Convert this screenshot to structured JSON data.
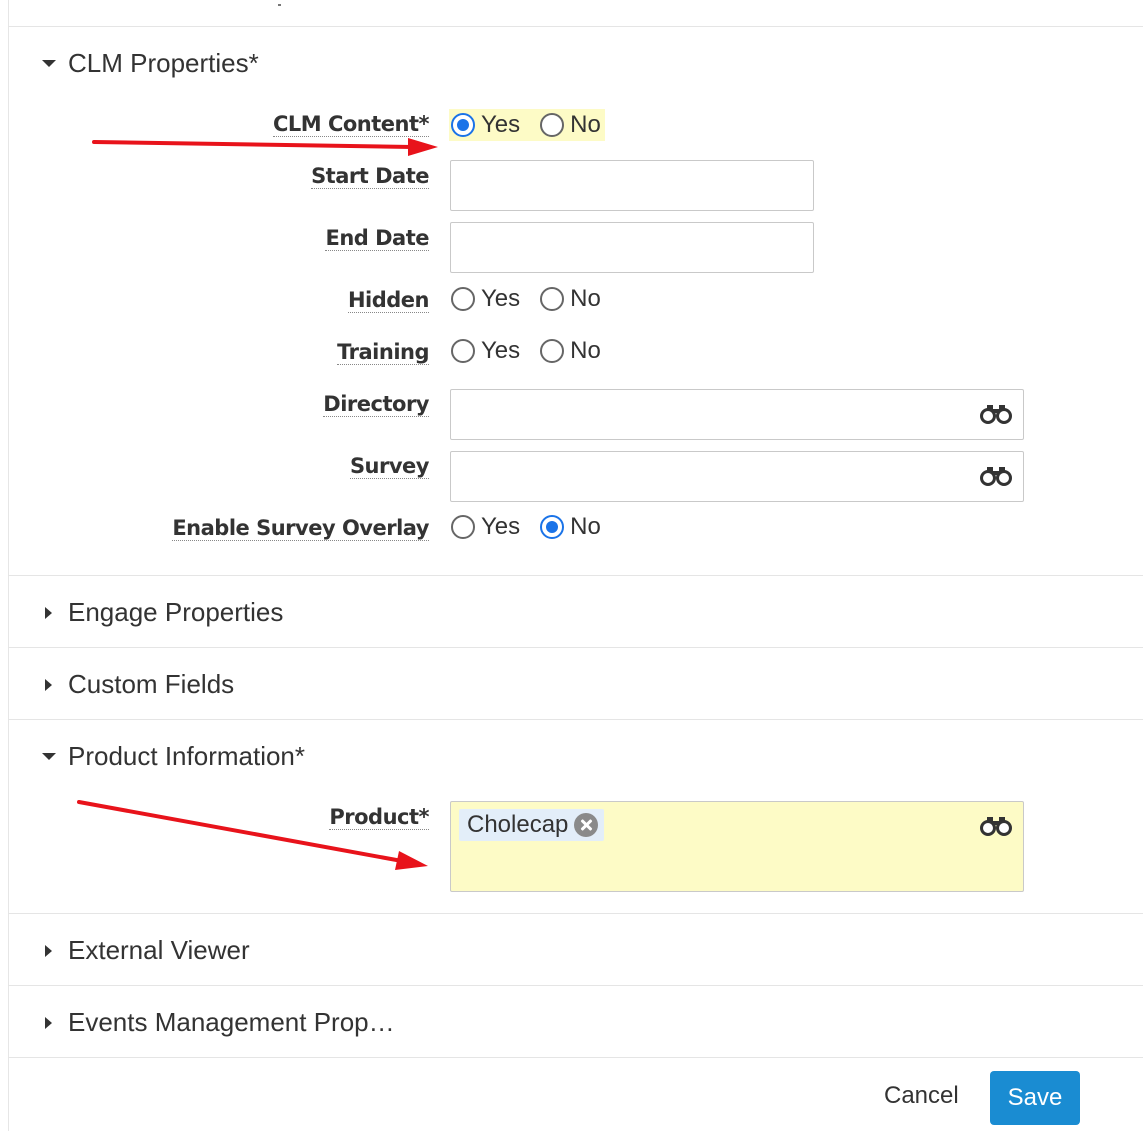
{
  "sections": {
    "clm": {
      "title": "CLM Properties*"
    },
    "engage": {
      "title": "Engage Properties"
    },
    "custom": {
      "title": "Custom Fields"
    },
    "product": {
      "title": "Product Information*"
    },
    "external": {
      "title": "External Viewer"
    },
    "events": {
      "title": "Events Management Prop…"
    }
  },
  "fields": {
    "clm_content": {
      "label": "CLM Content*",
      "yes": "Yes",
      "no": "No",
      "selected": "Yes"
    },
    "start_date": {
      "label": "Start Date",
      "value": ""
    },
    "end_date": {
      "label": "End Date",
      "value": ""
    },
    "hidden": {
      "label": "Hidden",
      "yes": "Yes",
      "no": "No",
      "selected": ""
    },
    "training": {
      "label": "Training",
      "yes": "Yes",
      "no": "No",
      "selected": ""
    },
    "directory": {
      "label": "Directory",
      "value": ""
    },
    "survey": {
      "label": "Survey",
      "value": ""
    },
    "enable_survey_overlay": {
      "label": "Enable Survey Overlay",
      "yes": "Yes",
      "no": "No",
      "selected": "No"
    },
    "product": {
      "label": "Product*",
      "tags": [
        "Cholecap"
      ]
    }
  },
  "footer": {
    "cancel_label": "Cancel",
    "save_label": "Save"
  },
  "colors": {
    "accent": "#1a73e8",
    "save_button": "#1a8cd2",
    "highlight": "#fdfbc6",
    "annotation_arrow": "#e8131b"
  },
  "icons": {
    "lookup": "binoculars-icon",
    "remove_tag": "close-circle-icon"
  }
}
